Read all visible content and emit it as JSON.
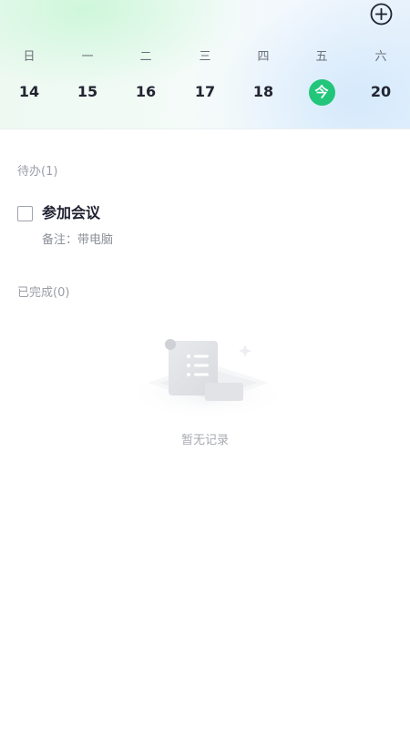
{
  "header": {
    "add_icon": "plus-circle-icon",
    "weekdays": [
      "日",
      "一",
      "二",
      "三",
      "四",
      "五",
      "六"
    ],
    "dates": [
      "14",
      "15",
      "16",
      "17",
      "18",
      "今",
      "20"
    ],
    "today_index": 5
  },
  "colors": {
    "accent": "#21c67a",
    "text_primary": "#1e2130",
    "text_secondary": "#9b9ea6"
  },
  "todo": {
    "section_title": "待办(1)",
    "items": [
      {
        "title": "参加会议",
        "note": "备注：带电脑",
        "checked": false
      }
    ]
  },
  "done": {
    "section_title": "已完成(0)",
    "empty_text": "暂无记录",
    "empty_icon": "empty-list-scroll-icon"
  }
}
